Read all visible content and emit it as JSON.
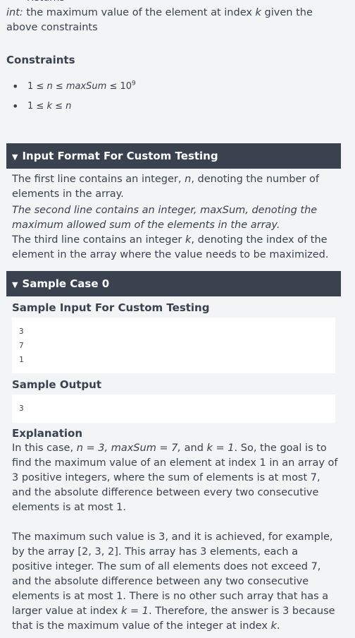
{
  "returns": {
    "heading": "Returns",
    "type": "int:",
    "desc_pre": " the maximum value of the element at index ",
    "desc_var": "k",
    "desc_post": " given the above constraints"
  },
  "constraints": {
    "title": "Constraints",
    "items": [
      {
        "lhs": "1 ≤ ",
        "v1": "n",
        "mid": " ≤ ",
        "v2": "maxSum",
        "rhs": " ≤ 10",
        "sup": "9"
      },
      {
        "lhs": "1 ≤ ",
        "v1": "k",
        "mid": " ≤ ",
        "v2": "n",
        "rhs": "",
        "sup": ""
      }
    ]
  },
  "input_format": {
    "header": "Input Format For Custom Testing",
    "line1_pre": "The first line contains an integer, ",
    "line1_var": "n",
    "line1_post": ", denoting the number of elements in the array.",
    "line2": "The second line contains an integer, maxSum, denoting the maximum allowed sum of the elements in the array.",
    "line3_pre": "The third line contains an integer ",
    "line3_var": "k",
    "line3_post": ", denoting the index of the element in the array where the value needs to be maximized."
  },
  "sample_case": {
    "header": "Sample Case 0",
    "input_title": "Sample Input For Custom Testing",
    "input_lines": [
      "3",
      "7",
      "1"
    ],
    "output_title": "Sample Output",
    "output_value": "3",
    "explanation_title": "Explanation",
    "exp1_pre": "In this case, ",
    "exp1_math": "n = 3, maxSum = 7,",
    "exp1_and": " and ",
    "exp1_k": "k = 1",
    "exp1_post": ". So, the goal is to find the maximum value of an element at index 1 in an array of 3 positive integers, where the sum of elements is at most 7, and the absolute difference between every two consecutive elements is at most 1.",
    "exp2_pre": "The maximum such value is 3, and it is achieved, for example, by the array [2, 3, 2]. This array has 3 elements, each a positive integer. The sum of all elements does not exceed 7, and the absolute difference between any two consecutive elements is at most 1. There is no other such array that has a larger value at index ",
    "exp2_k": "k = 1",
    "exp2_mid": ". Therefore, the answer is 3 because that is the maximum value of the integer at index ",
    "exp2_k2": "k",
    "exp2_end": "."
  }
}
